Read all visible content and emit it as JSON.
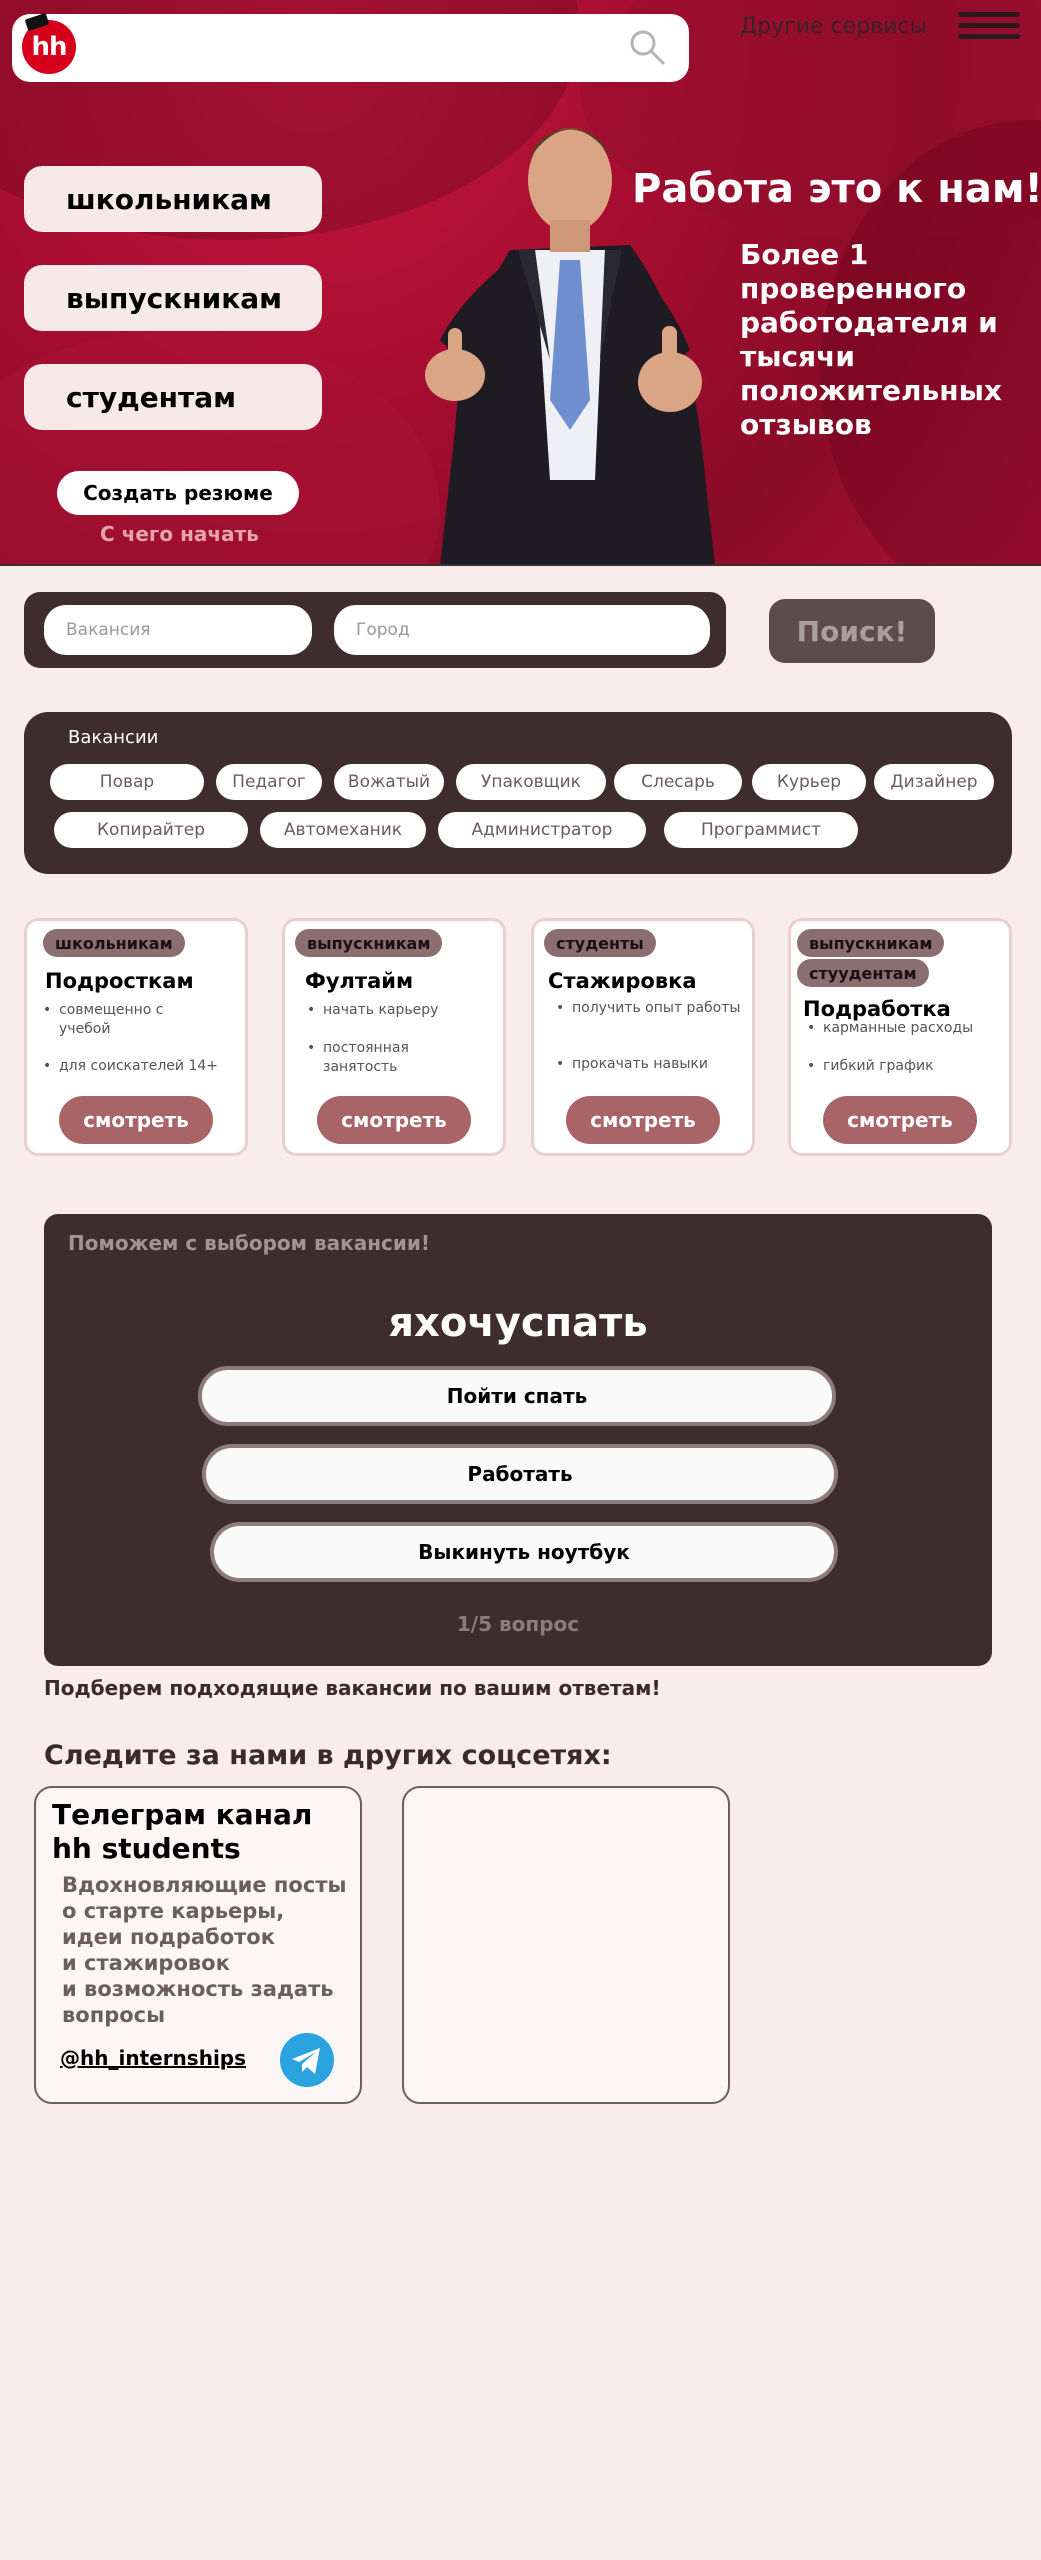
{
  "header": {
    "logo_text": "hh",
    "other_services": "Другие сервисы"
  },
  "hero": {
    "audience_buttons": [
      "школьникам",
      "выпускникам",
      "студентам"
    ],
    "create_resume": "Создать резюме",
    "how_to_start": "С чего начать",
    "title": "Работа это к нам!",
    "subtitle": "Более 1 проверенного работодателя и тысячи положительных отзывов"
  },
  "search": {
    "vacancy_placeholder": "Вакансия",
    "city_placeholder": "Город",
    "submit_label": "Поиск!"
  },
  "vacancies": {
    "title": "Вакансии",
    "chips": [
      "Повар",
      "Педагог",
      "Вожатый",
      "Упаковщик",
      "Слесарь",
      "Курьер",
      "Дизайнер",
      "Копирайтер",
      "Автомеханик",
      "Администратор",
      "Программист"
    ]
  },
  "cards": [
    {
      "tags": [
        "школьникам"
      ],
      "title": "Подросткам",
      "bullets": [
        "совмещенно с учебой",
        "для соискателей 14+"
      ],
      "button": "смотреть"
    },
    {
      "tags": [
        "выпускникам"
      ],
      "title": "Фултайм",
      "bullets": [
        "начать карьеру",
        "постоянная занятость"
      ],
      "button": "смотреть"
    },
    {
      "tags": [
        "студенты"
      ],
      "title": "Стажировка",
      "bullets": [
        "получить опыт работы",
        "прокачать навыки"
      ],
      "button": "смотреть"
    },
    {
      "tags": [
        "выпускникам",
        "стуудентам"
      ],
      "title": "Подработка",
      "bullets": [
        "карманные расходы",
        "гибкий график"
      ],
      "button": "смотреть"
    }
  ],
  "quiz": {
    "hint": "Поможем с выбором вакансии!",
    "question": "яхочуспать",
    "answers": [
      "Пойти спать",
      "Работать",
      "Выкинуть ноутбук"
    ],
    "progress": "1/5 вопрос",
    "after_text": "Подберем подходящие вакансии по вашим ответам!"
  },
  "social": {
    "heading": "Следите за нами в других соцсетях:",
    "telegram": {
      "title": "Телеграм канал hh students",
      "text": "Вдохновляющие посты\nо старте карьеры, идеи подработок\nи стажировок\nи возможность задать вопросы",
      "handle": "@hh_internships"
    }
  },
  "colors": {
    "brand_red": "#a50d30",
    "panel_dark": "#3e2c2e",
    "page_bg": "#f9ecec",
    "button_rose": "#a86467"
  }
}
